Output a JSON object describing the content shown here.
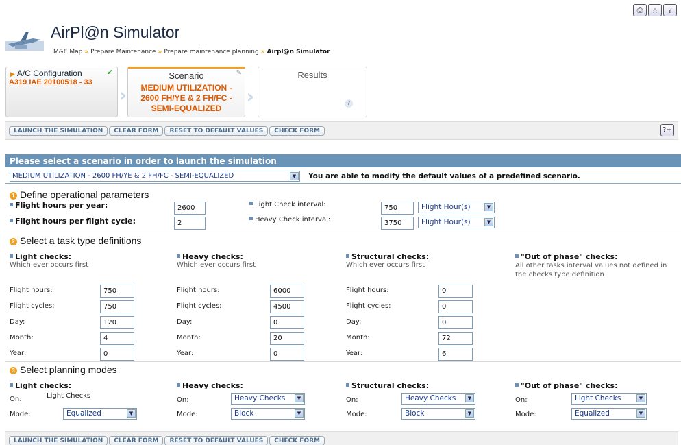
{
  "top_icons": [
    "print-icon",
    "favorite-icon",
    "help-icon"
  ],
  "header": {
    "title": "AirPl@n Simulator",
    "breadcrumb": [
      "M&E Map",
      "Prepare Maintenance",
      "Prepare maintenance planning",
      "Airpl@n Simulator"
    ]
  },
  "steps": {
    "config": {
      "label": "A/C Configuration",
      "value": "A319 IAE 20100518 - 33"
    },
    "scenario": {
      "label": "Scenario",
      "value": "MEDIUM UTILIZATION - 2600 FH/YE & 2 FH/FC - SEMI-EQUALIZED"
    },
    "results": {
      "label": "Results",
      "help": "?"
    }
  },
  "toolbar": {
    "launch": "LAUNCH THE SIMULATION",
    "clear": "CLEAR FORM",
    "reset": "RESET TO DEFAULT VALUES",
    "check": "CHECK FORM",
    "help": "?+"
  },
  "banner": "Please select a scenario in order to launch the simulation",
  "scenario_select": "MEDIUM UTILIZATION - 2600 FH/YE & 2 FH/FC - SEMI-EQUALIZED",
  "scenario_note": "You are able to modify the default values of a predefined scenario.",
  "section1": {
    "heading": "Define operational parameters",
    "fh_year_label": "Flight hours per year:",
    "fh_year": "2600",
    "fh_cycle_label": "Flight hours per flight cycle:",
    "fh_cycle": "2",
    "light_label": "Light Check interval:",
    "light_value": "750",
    "light_unit": "Flight Hour(s)",
    "heavy_label": "Heavy Check interval:",
    "heavy_value": "3750",
    "heavy_unit": "Flight Hour(s)"
  },
  "section2": {
    "heading": "Select a task type definitions",
    "light": {
      "title": "Light checks:",
      "sub": "Which ever occurs first",
      "values": [
        "750",
        "750",
        "120",
        "4",
        "0"
      ]
    },
    "heavy": {
      "title": "Heavy checks:",
      "sub": "Which ever occurs first",
      "values": [
        "6000",
        "4500",
        "0",
        "20",
        "0"
      ]
    },
    "structural": {
      "title": "Structural checks:",
      "sub": "Which ever occurs first",
      "values": [
        "0",
        "0",
        "0",
        "72",
        "6"
      ]
    },
    "oop": {
      "title": "\"Out of phase\" checks:",
      "sub": "All other tasks interval values not defined in the checks type definition"
    },
    "row_labels": [
      "Flight hours:",
      "Flight cycles:",
      "Day:",
      "Month:",
      "Year:"
    ]
  },
  "section3": {
    "heading": "Select planning modes",
    "on_label": "On:",
    "mode_label": "Mode:",
    "light": {
      "title": "Light checks:",
      "on": "Light Checks",
      "mode": "Equalized"
    },
    "heavy": {
      "title": "Heavy checks:",
      "on": "Heavy Checks",
      "mode": "Block"
    },
    "structural": {
      "title": "Structural checks:",
      "on": "Heavy Checks",
      "mode": "Block"
    },
    "oop": {
      "title": "\"Out of phase\" checks:",
      "on": "Light Checks",
      "mode": "Equalized"
    }
  }
}
